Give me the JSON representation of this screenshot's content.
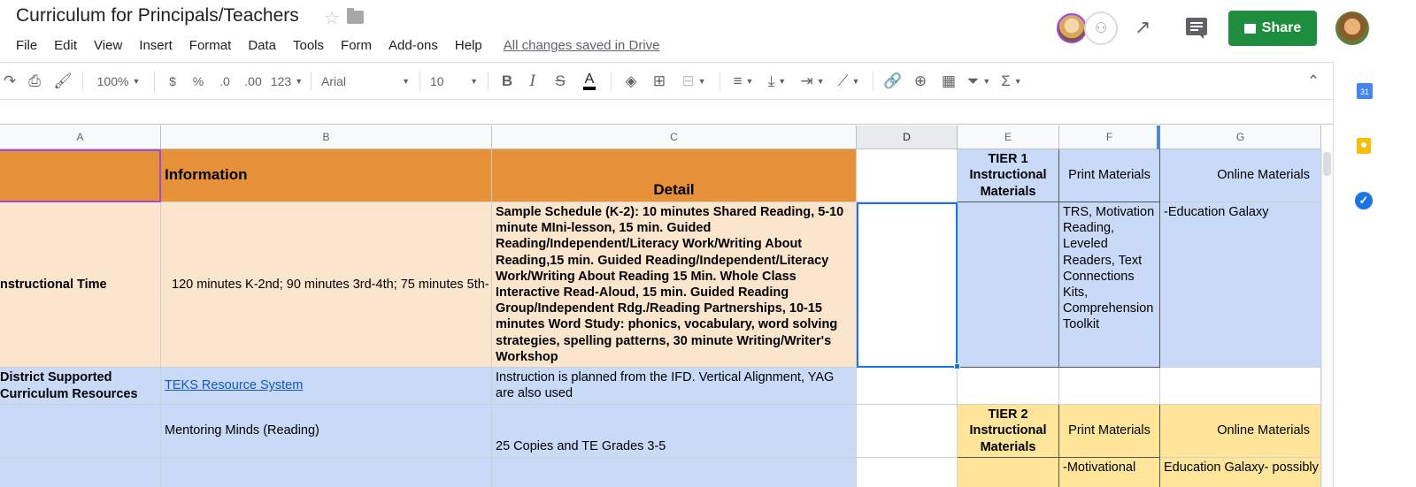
{
  "header": {
    "title": "Curriculum for Principals/Teachers",
    "saved_status": "All changes saved in Drive",
    "share_label": "Share"
  },
  "menu": [
    "File",
    "Edit",
    "View",
    "Insert",
    "Format",
    "Data",
    "Tools",
    "Form",
    "Add-ons",
    "Help"
  ],
  "toolbar": {
    "zoom": "100%",
    "currency": "$",
    "percent": "%",
    "decrease_decimal": ".0",
    "increase_decimal": ".00",
    "more_formats": "123",
    "font": "Arial",
    "font_size": "10",
    "bold": "B",
    "italic": "I",
    "strike": "S",
    "text_color": "A"
  },
  "side_panel": {
    "calendar_label": "31"
  },
  "colors": {
    "orange": "#e69138",
    "peach": "#fce5cd",
    "blue": "#c9daf8",
    "yellow": "#ffe599",
    "share_green": "#1e8e3e",
    "selection": "#1a73e8"
  },
  "columns": [
    "A",
    "B",
    "C",
    "D",
    "E",
    "F",
    "G"
  ],
  "rows": {
    "r1": {
      "b": "Information",
      "c": "Detail",
      "e": "TIER 1 Instructional Materials",
      "f": "Print Materials",
      "g": "Online Materials"
    },
    "r2": {
      "a": "nstructional Time",
      "b": "120 minutes K-2nd; 90 minutes 3rd-4th; 75 minutes 5th-",
      "c": "Sample Schedule (K-2):     10 minutes Shared Reading, 5-10 minute MIni-lesson, 15 min. Guided Reading/Independent/Literacy Work/Writing About Reading,15 min. Guided Reading/Independent/Literacy Work/Writing About Reading  15 Min. Whole Class Interactive Read-Aloud, 15 min.  Guided Reading Group/Independent Rdg./Reading Partnerships, 10-15 minutes Word Study:  phonics, vocabulary, word solving strategies, spelling patterns, 30 minute Writing/Writer's Workshop",
      "f": "TRS, Motivation Reading, Leveled Readers, Text Connections Kits, Comprehension Toolkit",
      "g": "-Education Galaxy"
    },
    "r3": {
      "a": "District Supported Curriculum Resources",
      "b": "TEKS Resource System",
      "c": "Instruction is planned from the IFD.  Vertical Alignment, YAG are also used"
    },
    "r4": {
      "b": "Mentoring Minds (Reading)",
      "c": "25 Copies and TE Grades 3-5",
      "e": "TIER 2 Instructional Materials",
      "f": "Print Materials",
      "g": "Online Materials"
    },
    "r5": {
      "f": "-Motivational",
      "g": "Education Galaxy- possibly"
    }
  }
}
